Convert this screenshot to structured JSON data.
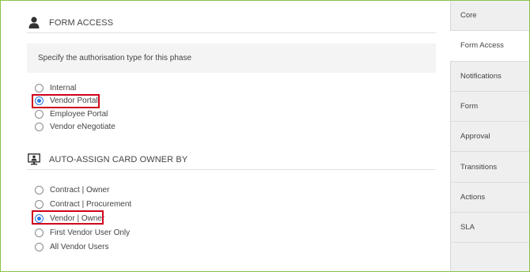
{
  "form_access": {
    "title": "FORM ACCESS",
    "icon": "user-icon",
    "info_text": "Specify the authorisation type for this phase",
    "options": [
      {
        "label": "Internal",
        "checked": false
      },
      {
        "label": "Vendor Portal",
        "checked": true
      },
      {
        "label": "Employee Portal",
        "checked": false
      },
      {
        "label": "Vendor eNegotiate",
        "checked": false
      }
    ]
  },
  "auto_assign": {
    "title": "AUTO-ASSIGN CARD OWNER BY",
    "icon": "monitor-user-icon",
    "options": [
      {
        "label": "Contract | Owner",
        "checked": false
      },
      {
        "label": "Contract | Procurement",
        "checked": false
      },
      {
        "label": "Vendor | Owner",
        "checked": true
      },
      {
        "label": "First Vendor User Only",
        "checked": false
      },
      {
        "label": "All Vendor Users",
        "checked": false
      }
    ]
  },
  "sidebar": {
    "tabs": [
      {
        "label": "Core",
        "active": false
      },
      {
        "label": "Form Access",
        "active": true
      },
      {
        "label": "Notifications",
        "active": false
      },
      {
        "label": "Form",
        "active": false
      },
      {
        "label": "Approval",
        "active": false
      },
      {
        "label": "Transitions",
        "active": false
      },
      {
        "label": "Actions",
        "active": false
      },
      {
        "label": "SLA",
        "active": false
      }
    ]
  },
  "colors": {
    "accent": "#2a7ae2",
    "highlight": "#d0021b",
    "frame": "#8bc34a"
  }
}
